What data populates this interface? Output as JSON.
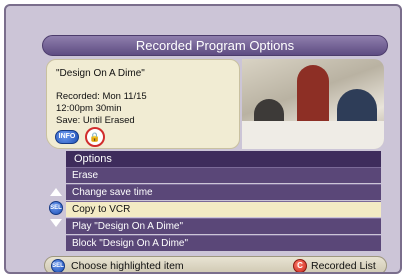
{
  "title": "Recorded Program Options",
  "program": {
    "name": "\"Design On A Dime\"",
    "recorded": "Recorded: Mon 11/15",
    "time_duration": "12:00pm  30min",
    "save": "Save: Until Erased",
    "info_button": "INFO",
    "lock_icon_glyph": "🔒"
  },
  "options": {
    "header": "Options",
    "items": [
      {
        "label": "Erase",
        "highlighted": false
      },
      {
        "label": "Change save time",
        "highlighted": false
      },
      {
        "label": "Copy to VCR",
        "highlighted": true
      },
      {
        "label": "Play \"Design On A Dime\"",
        "highlighted": false
      },
      {
        "label": "Block \"Design On A Dime\"",
        "highlighted": false
      }
    ]
  },
  "scroll": {
    "sel_label": "SEL"
  },
  "footer": {
    "sel_label": "SEL",
    "choose": "Choose highlighted item",
    "c_label": "C",
    "recorded_list": "Recorded List"
  },
  "colors": {
    "background": "#ccc5d7",
    "title_bar": "#5e4c82",
    "option_row": "#5a4778",
    "highlight": "#f3ebc4"
  }
}
